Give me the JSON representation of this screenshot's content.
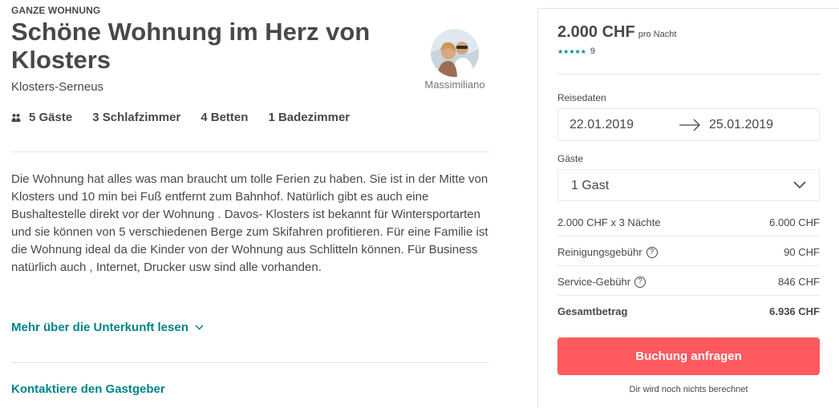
{
  "listing": {
    "kind": "GANZE WOHNUNG",
    "title": "Schöne Wohnung im Herz von Klosters",
    "location": "Klosters-Serneus",
    "host_name": "Massimiliano",
    "facts": [
      "5 Gäste",
      "3 Schlafzimmer",
      "4 Betten",
      "1 Badezimmer"
    ],
    "description": "Die Wohnung hat alles was man braucht um tolle Ferien zu haben. Sie ist in der Mitte von Klosters und 10 min bei Fuß entfernt zum Bahnhof. Natürlich gibt es auch eine Bushaltestelle direkt vor der Wohnung . Davos- Klosters ist bekannt für Wintersportarten und sie können von 5 verschiedenen Berge zum Skifahren profitieren. Für eine Familie ist die Wohnung ideal da die Kinder von der Wohnung aus Schlitteln können. Für Business natürlich auch , Internet, Drucker usw sind alle vorhanden.",
    "read_more": "Mehr über die Unterkunft lesen",
    "contact_host": "Kontaktiere den Gastgeber"
  },
  "booking": {
    "price": "2.000 CHF",
    "per_night": "pro Nacht",
    "stars": "★★★★★",
    "review_count": "9",
    "dates_label": "Reisedaten",
    "check_in": "22.01.2019",
    "check_out": "25.01.2019",
    "guests_label": "Gäste",
    "guests_value": "1 Gast",
    "lines": [
      {
        "label": "2.000 CHF x 3 Nächte",
        "value": "6.000 CHF"
      },
      {
        "label": "Reinigungsgebühr",
        "value": "90 CHF"
      },
      {
        "label": "Service-Gebühr",
        "value": "846 CHF"
      }
    ],
    "total_label": "Gesamtbetrag",
    "total_value": "6.936 CHF",
    "button_label": "Buchung anfragen",
    "note": "Dir wird noch nichts berechnet"
  },
  "colors": {
    "accent": "#008489",
    "button": "#ff5a5f",
    "text": "#484848"
  },
  "icons": [
    "guests-icon",
    "chevron-down-icon",
    "arrow-right-icon",
    "help-icon",
    "star-icon"
  ]
}
